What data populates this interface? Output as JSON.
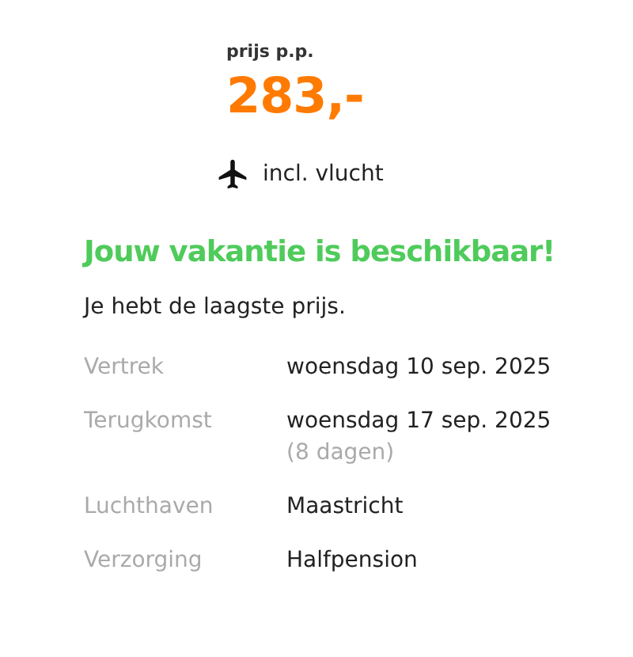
{
  "price": {
    "label": "prijs p.p.",
    "amount": "283,-"
  },
  "includes": {
    "text": "incl. vlucht"
  },
  "status": {
    "title": "Jouw vakantie is beschikbaar!",
    "subtitle": "Je hebt de laagste prijs."
  },
  "details": [
    {
      "label": "Vertrek",
      "value": "woensdag 10 sep. 2025"
    },
    {
      "label": "Terugkomst",
      "value": "woensdag 17 sep. 2025",
      "note": "(8 dagen)"
    },
    {
      "label": "Luchthaven",
      "value": "Maastricht"
    },
    {
      "label": "Verzorging",
      "value": "Halfpension"
    }
  ]
}
